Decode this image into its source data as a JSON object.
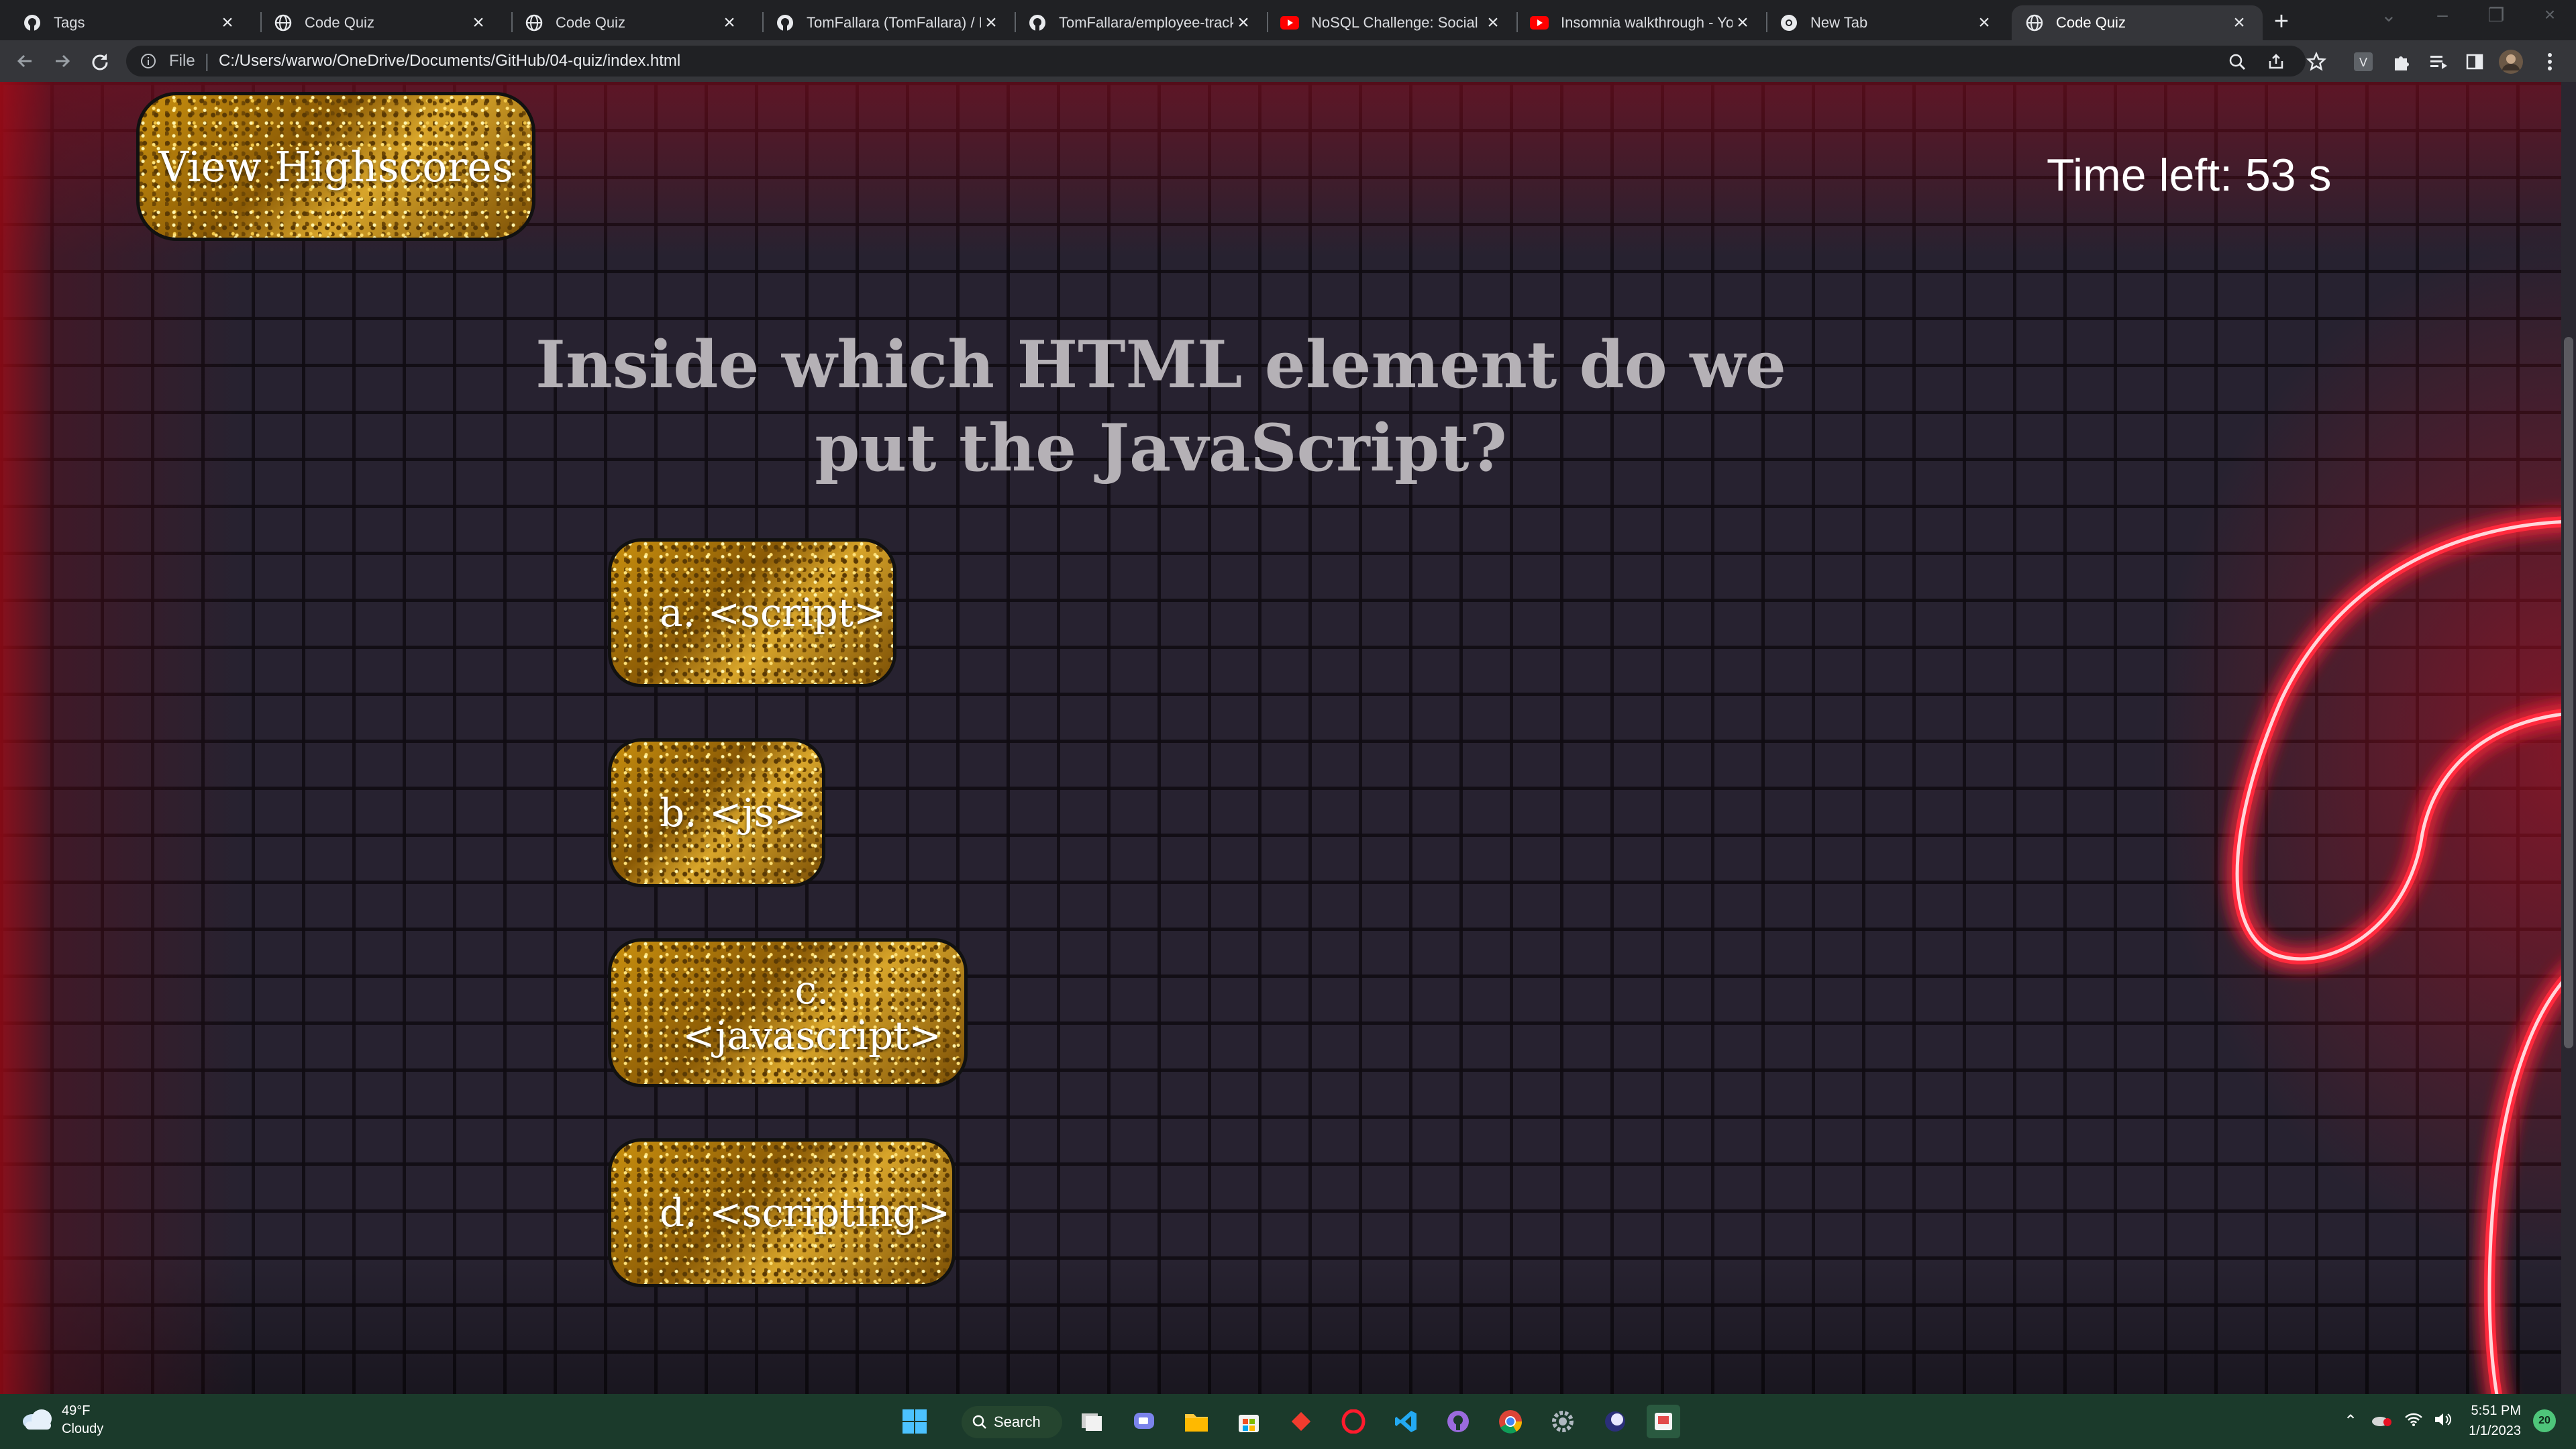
{
  "browser": {
    "tabs": [
      {
        "title": "Tags",
        "icon": "github-icon",
        "active": false
      },
      {
        "title": "Code Quiz",
        "icon": "globe-icon",
        "active": false
      },
      {
        "title": "Code Quiz",
        "icon": "globe-icon",
        "active": false
      },
      {
        "title": "TomFallara (TomFallara) / Re",
        "icon": "github-icon",
        "active": false
      },
      {
        "title": "TomFallara/employee-track",
        "icon": "github-icon",
        "active": false
      },
      {
        "title": "NoSQL Challenge: Social Ne",
        "icon": "youtube-icon",
        "active": false
      },
      {
        "title": "Insomnia walkthrough - You",
        "icon": "youtube-icon",
        "active": false
      },
      {
        "title": "New Tab",
        "icon": "chrome-icon",
        "active": false
      },
      {
        "title": "Code Quiz",
        "icon": "globe-icon",
        "active": true
      }
    ],
    "address": {
      "scheme_label": "File",
      "url": "C:/Users/warwo/OneDrive/Documents/GitHub/04-quiz/index.html"
    }
  },
  "page": {
    "view_highscores_label": "View Highscores",
    "timer_text": "Time left: 53 s",
    "question": "Inside which HTML element do we put the JavaScript?",
    "answers": [
      {
        "label": "a. <script>"
      },
      {
        "label": "b. <js>"
      },
      {
        "label": "c. <javascript>"
      },
      {
        "label": "d. <scripting>"
      }
    ]
  },
  "taskbar": {
    "weather_temp": "49°F",
    "weather_desc": "Cloudy",
    "search_label": "Search",
    "time": "5:51 PM",
    "date": "1/1/2023",
    "notification_count": "20"
  },
  "colors": {
    "accent_gold": "#c9900f",
    "neon_red": "#ff2a3c",
    "question_text": "#b5b1b6"
  }
}
